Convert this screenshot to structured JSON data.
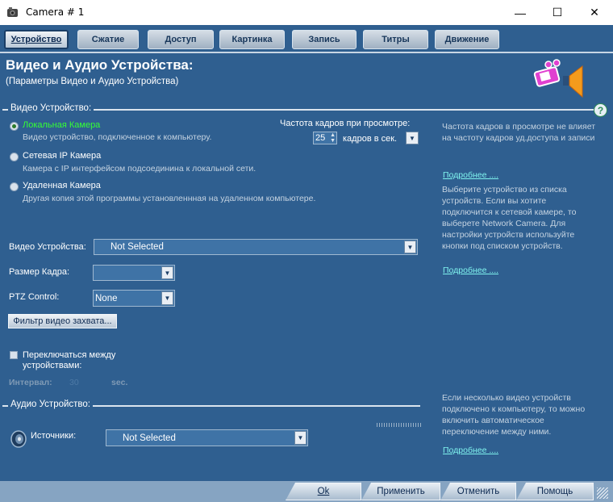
{
  "window": {
    "title": "Camera # 1",
    "minimize": "—",
    "maximize": "☐",
    "close": "✕"
  },
  "tabs": [
    "Устройство",
    "Сжатие",
    "Доступ",
    "Картинка",
    "Запись",
    "Титры",
    "Движение"
  ],
  "header": {
    "title": "Видео и Аудио Устройства:",
    "subtitle": "(Параметры Видео и Аудио Устройства)"
  },
  "video_section": {
    "label": "Видео Устройство:",
    "options": [
      {
        "label": "Локальная Камера",
        "desc": "Видео устройство, подключенное к компьютеру.",
        "selected": true
      },
      {
        "label": "Сетевая IP Камера",
        "desc": "Камера с IP интерфейсом подсоединина к локальной сети.",
        "selected": false
      },
      {
        "label": "Удаленная Камера",
        "desc": "Другая копия этой программы установленнная на удаленном компьютере.",
        "selected": false
      }
    ],
    "fps_label": "Частота кадров при просмотре:",
    "fps_value": "25",
    "fps_unit": "кадров в сек.",
    "device_label": "Видео Устройства:",
    "device_value": "Not Selected",
    "frame_size_label": "Размер Кадра:",
    "frame_size_value": "",
    "ptz_label": "PTZ Control:",
    "ptz_value": "None",
    "filter_button": "Фильтр видео захвата...",
    "switch_label_1": "Переключаться между",
    "switch_label_2": "устройствами:",
    "interval_label": "Интервал:",
    "interval_value": "30",
    "interval_unit": "sec."
  },
  "audio_section": {
    "label": "Аудио Устройство:",
    "source_label": "Источники:",
    "source_value": "Not Selected"
  },
  "help": {
    "help_icon": "?",
    "fps_help": [
      "Частота кадров в просмотре не влияет",
      "на частоту кадров уд.доступа и записи"
    ],
    "more": "Подробнее ....",
    "device_help": [
      "Выберите устройство из списка",
      "устройств. Если вы хотите",
      "подключится к сетевой камере, то",
      "выберете Network Camera. Для",
      "настройки устройств используйте",
      "кнопки под списком устройств."
    ],
    "switch_help": [
      "Если несколько видео устройств",
      "подключено к компьютеру, то можно",
      "включить автоматическое",
      "переключение между ними."
    ]
  },
  "footer": {
    "ok": "Ok",
    "apply": "Применить",
    "cancel": "Отменить",
    "help": "Помощь"
  },
  "colors": {
    "background": "#2f5f90",
    "link": "#7ff3ee",
    "selected_option": "#35ff35"
  }
}
